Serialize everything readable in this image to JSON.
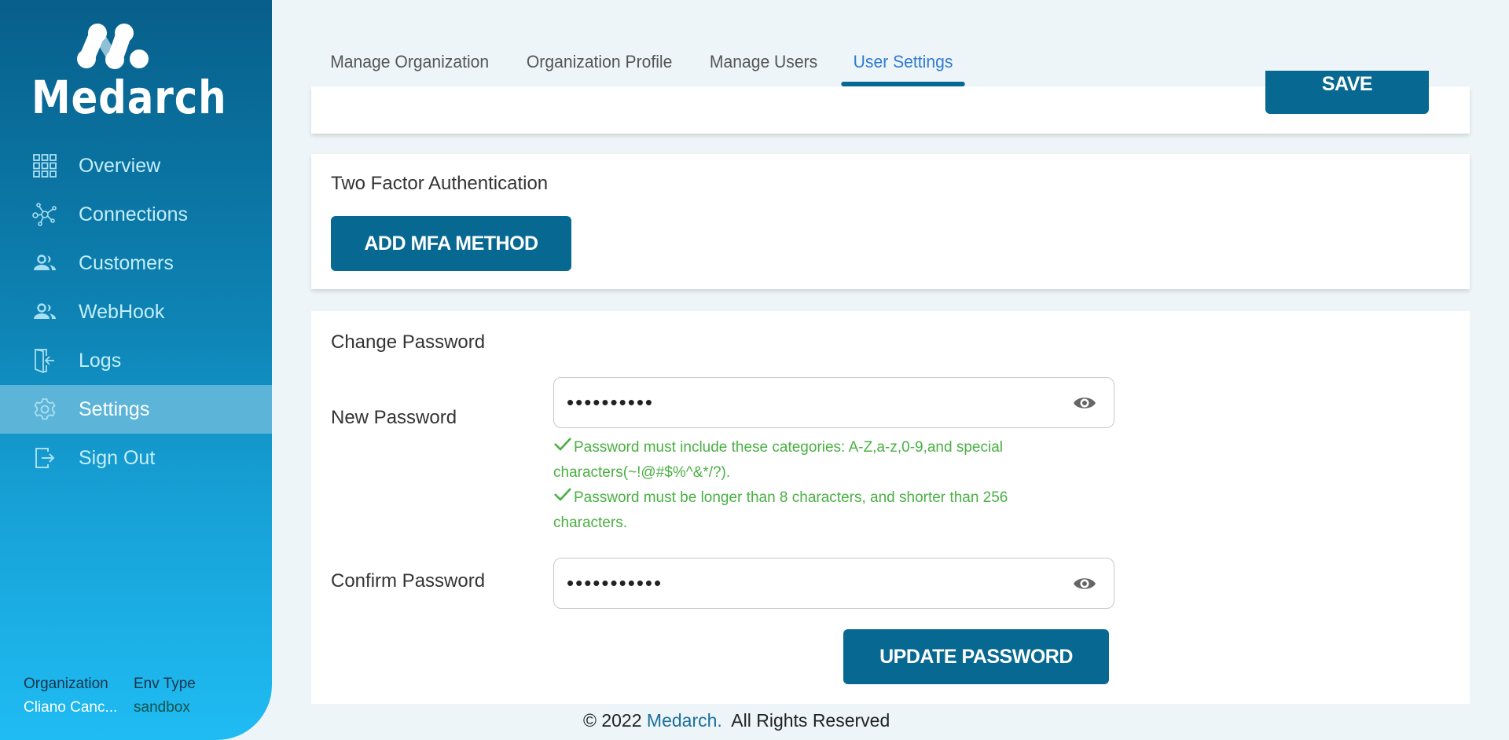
{
  "brand": {
    "name": "Medarch",
    "accent": "#076892",
    "sidebar_active": "#5cb5d9"
  },
  "sidebar": {
    "items": [
      {
        "label": "Overview",
        "icon": "grid-icon",
        "active": false
      },
      {
        "label": "Connections",
        "icon": "network-icon",
        "active": false
      },
      {
        "label": "Customers",
        "icon": "users-icon",
        "active": false
      },
      {
        "label": "WebHook",
        "icon": "users-icon",
        "active": false
      },
      {
        "label": "Logs",
        "icon": "door-enter-icon",
        "active": false
      },
      {
        "label": "Settings",
        "icon": "gear-icon",
        "active": true
      },
      {
        "label": "Sign Out",
        "icon": "sign-out-icon",
        "active": false
      }
    ],
    "org": {
      "org_label": "Organization",
      "org_value": "Cliano Canc...",
      "env_label": "Env Type",
      "env_value": "sandbox"
    }
  },
  "tabs": [
    {
      "label": "Manage Organization",
      "active": false
    },
    {
      "label": "Organization Profile",
      "active": false
    },
    {
      "label": "Manage Users",
      "active": false
    },
    {
      "label": "User Settings",
      "active": true
    }
  ],
  "top_card": {
    "save_label": "SAVE"
  },
  "mfa": {
    "title": "Two Factor Authentication",
    "button_label": "ADD MFA METHOD"
  },
  "password": {
    "title": "Change Password",
    "new_label": "New Password",
    "new_value": "••••••••••",
    "confirm_label": "Confirm Password",
    "confirm_value": "•••••••••••",
    "rules": [
      {
        "text": "Password must include these categories: A-Z,a-z,0-9,and special characters(~!@#$%^&*/?).",
        "satisfied": true
      },
      {
        "text": "Password must be longer than 8 characters, and shorter than 256 characters.",
        "satisfied": true
      }
    ],
    "rule_color": "#4ab043",
    "update_label": "UPDATE PASSWORD"
  },
  "footer": {
    "prefix": "© 2022 ",
    "brand": "Medarch.",
    "suffix": "  All Rights Reserved"
  }
}
